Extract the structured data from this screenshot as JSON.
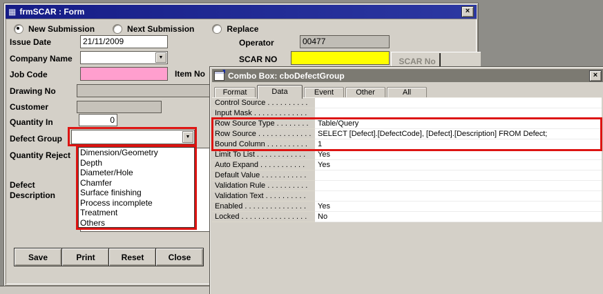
{
  "window": {
    "title": "frmSCAR : Form",
    "radios": [
      {
        "label": "New Submission",
        "selected": true
      },
      {
        "label": "Next Submission",
        "selected": false
      },
      {
        "label": "Replace",
        "selected": false
      }
    ],
    "labels": {
      "issue_date": "Issue Date",
      "company_name": "Company Name",
      "job_code": "Job Code",
      "item_no": "Item No",
      "drawing_no": "Drawing No",
      "customer": "Customer",
      "quantity_in": "Quantity In",
      "defect_group": "Defect Group",
      "quantity_reject": "Quantity Reject",
      "defect_line1": "Defect",
      "defect_line2": "Description",
      "operator": "Operator",
      "scar_no": "SCAR NO"
    },
    "values": {
      "issue_date": "21/11/2009",
      "quantity_in": "0",
      "operator": "00477",
      "company_name": "",
      "job_code": "",
      "scar_no": ""
    },
    "scar_no_button": "SCAR No",
    "dropdown_items": [
      "Dimension/Geometry",
      "Depth",
      "Diameter/Hole",
      "Chamfer",
      "Surface finishing",
      "Process incomplete",
      "Treatment",
      "Others"
    ],
    "buttons": [
      "Save",
      "Print",
      "Reset",
      "Close"
    ]
  },
  "dialog": {
    "title": "Combo Box: cboDefectGroup",
    "tabs": [
      "Format",
      "Data",
      "Event",
      "Other",
      "All"
    ],
    "active_tab": "Data",
    "rows": [
      {
        "label": "Control Source . . . . . . . . . .",
        "value": ""
      },
      {
        "label": "Input Mask . . . . . . . . . . . . .",
        "value": ""
      },
      {
        "label": "Row Source Type . . . . . . . .",
        "value": "Table/Query"
      },
      {
        "label": "Row Source . . . . . . . . . . . . .",
        "value": "SELECT [Defect].[DefectCode], [Defect].[Description] FROM Defect;"
      },
      {
        "label": "Bound Column . . . . . . . . . .",
        "value": "1"
      },
      {
        "label": "Limit To List . . . . . . . . . . . .",
        "value": "Yes"
      },
      {
        "label": "Auto Expand . . . . . . . . . . .",
        "value": "Yes"
      },
      {
        "label": "Default Value . . . . . . . . . . .",
        "value": ""
      },
      {
        "label": "Validation Rule . . . . . . . . . .",
        "value": ""
      },
      {
        "label": "Validation Text . . . . . . . . . .",
        "value": ""
      },
      {
        "label": "Enabled . . . . . . . . . . . . . . .",
        "value": "Yes"
      },
      {
        "label": "Locked . . . . . . . . . . . . . . . .",
        "value": "No"
      }
    ]
  },
  "icons": {
    "close_glyph": "×",
    "dropdown_arrow": "▼",
    "form_glyph": "▦"
  },
  "colors": {
    "annotation_red": "#dd1412",
    "scar_field_yellow": "#ffff00",
    "job_code_pink": "#ff9fce",
    "titlebar_navy": "#151c86"
  }
}
